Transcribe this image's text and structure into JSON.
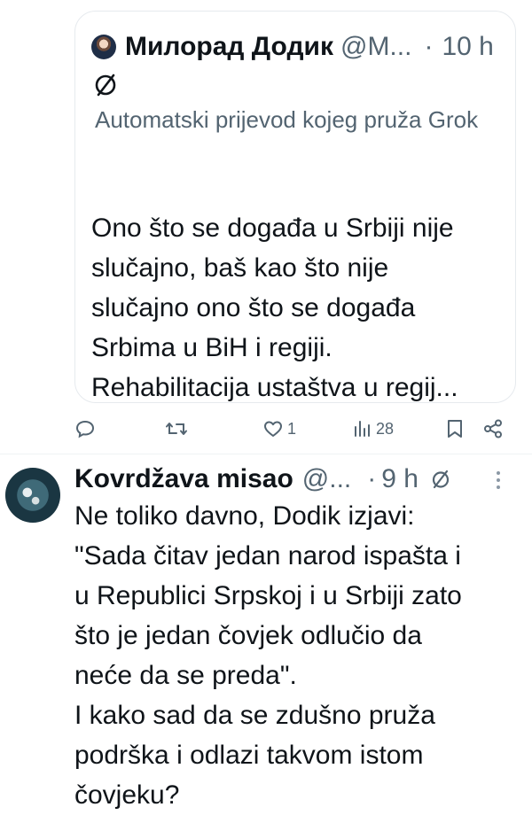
{
  "quoted_tweet": {
    "author_name": "Милорад Додик",
    "handle": "@M...",
    "separator": "·",
    "time": "10 h",
    "translation_note": "Automatski prijevod kojeg pruža Grok",
    "text": "Ono što se događa u Srbiji nije\nslučajno, baš kao što nije\nslučajno ono što se događa\nSrbima u BiH i regiji.\nRehabilitacija ustaštva u regij..."
  },
  "actions": {
    "reply_icon": "reply-icon",
    "retweet_icon": "retweet-icon",
    "like_icon": "heart-icon",
    "likes": "1",
    "views_icon": "views-icon",
    "views": "28",
    "bookmark_icon": "bookmark-icon",
    "share_icon": "share-icon"
  },
  "reply_tweet": {
    "author_name": "Kovrdžava misao",
    "handle": "@...",
    "separator": "·",
    "time": "9 h",
    "text": "Ne toliko davno, Dodik izjavi:\n\"Sada čitav jedan narod ispašta i\nu Republici Srpskoj i u Srbiji zato\nšto je jedan čovjek odlučio da\nneće da se preda\".\nI kako sad da se zdušno pruža\npodrška i odlazi takvom istom\nčovjeku?"
  },
  "colors": {
    "text": "#0f1419",
    "secondary": "#536471",
    "border": "#e6eaee"
  }
}
